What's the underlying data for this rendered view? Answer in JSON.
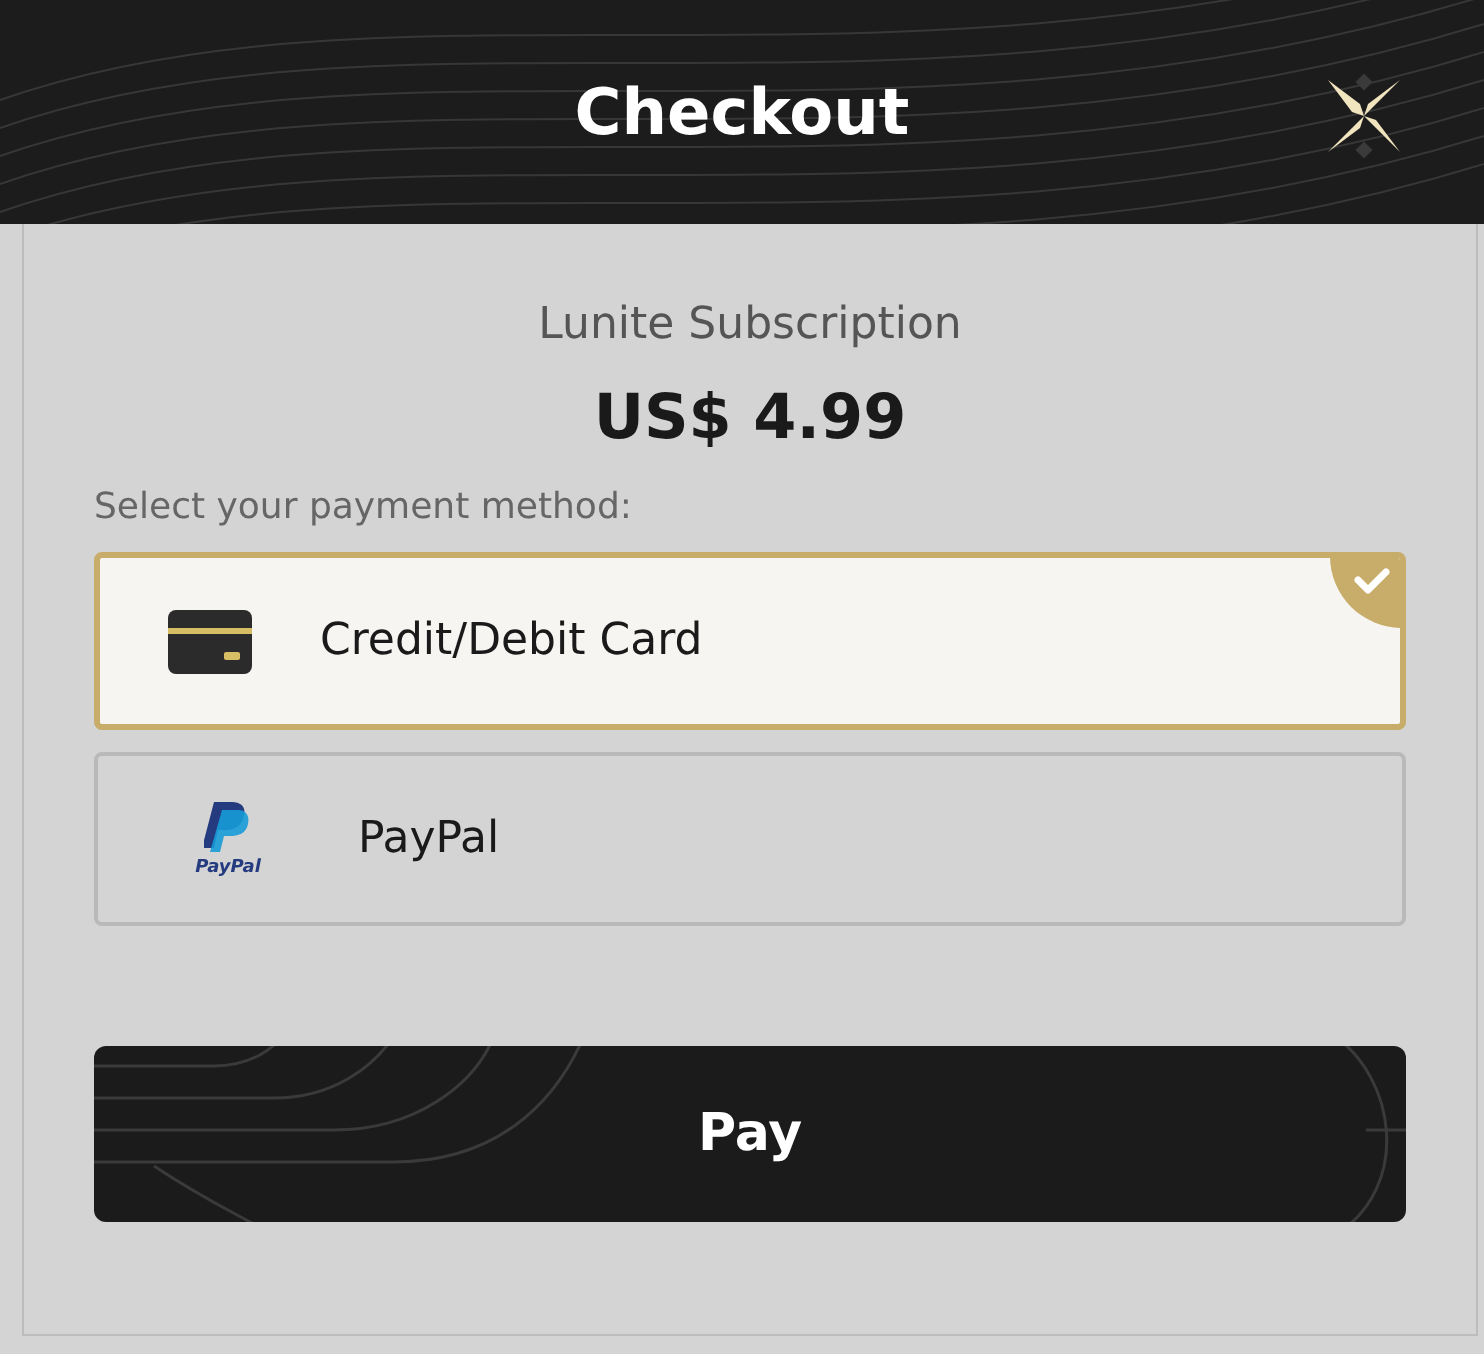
{
  "header": {
    "title": "Checkout"
  },
  "product": {
    "name": "Lunite Subscription",
    "price": "US$ 4.99"
  },
  "payment": {
    "prompt": "Select your payment method:",
    "methods": [
      {
        "kind": "card",
        "label": "Credit/Debit Card",
        "selected": true
      },
      {
        "kind": "paypal",
        "label": "PayPal",
        "logo_text": "PayPal",
        "selected": false
      }
    ]
  },
  "pay_button": {
    "label": "Pay"
  }
}
